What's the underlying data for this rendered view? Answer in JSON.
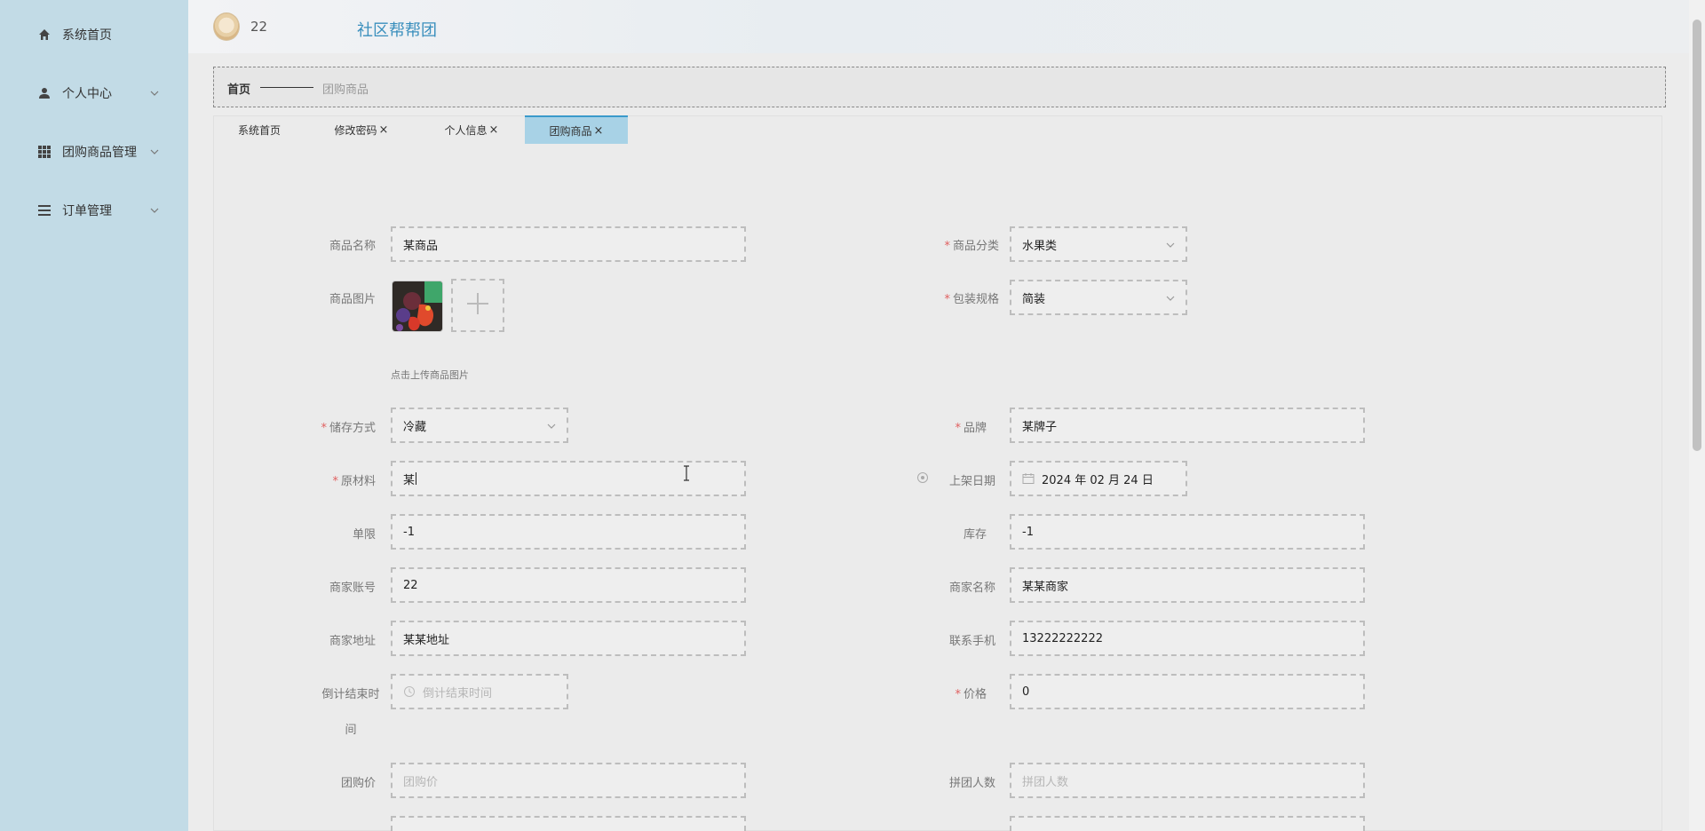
{
  "sidebar": {
    "items": [
      {
        "label": "系统首页",
        "icon": "home-icon"
      },
      {
        "label": "个人中心",
        "icon": "user-icon"
      },
      {
        "label": "团购商品管理",
        "icon": "grid-icon"
      },
      {
        "label": "订单管理",
        "icon": "list-icon"
      }
    ]
  },
  "header": {
    "user_no": "22",
    "site_title": "社区帮帮团"
  },
  "breadcrumb": {
    "home": "首页",
    "current": "团购商品"
  },
  "tabs": [
    {
      "label": "系统首页",
      "closable": false
    },
    {
      "label": "修改密码",
      "closable": true
    },
    {
      "label": "个人信息",
      "closable": true
    },
    {
      "label": "团购商品",
      "closable": true,
      "active": true
    }
  ],
  "tab_close_glyph": "×",
  "form": {
    "name": {
      "label": "商品名称",
      "value": "某商品"
    },
    "category": {
      "label": "商品分类",
      "value": "水果类",
      "required": true
    },
    "image": {
      "label": "商品图片",
      "hint": "点击上传商品图片"
    },
    "package": {
      "label": "包装规格",
      "value": "简装",
      "required": true
    },
    "storage": {
      "label": "储存方式",
      "value": "冷藏",
      "required": true
    },
    "brand": {
      "label": "品牌",
      "value": "某牌子",
      "required": true
    },
    "material": {
      "label": "原材料",
      "value": "某",
      "required": true
    },
    "shelf_date": {
      "label": "上架日期",
      "value": "2024 年 02 月 24 日"
    },
    "limit": {
      "label": "单限",
      "value": "-1"
    },
    "stock": {
      "label": "库存",
      "value": "-1"
    },
    "merchant_account": {
      "label": "商家账号",
      "value": "22"
    },
    "merchant_name": {
      "label": "商家名称",
      "value": "某某商家"
    },
    "merchant_address": {
      "label": "商家地址",
      "value": "某某地址"
    },
    "phone": {
      "label": "联系手机",
      "value": "13222222222"
    },
    "countdown": {
      "label_line1": "倒计结束时",
      "label_line2": "间",
      "placeholder": "倒计结束时间"
    },
    "price": {
      "label": "价格",
      "value": "0",
      "required": true
    },
    "group_price": {
      "label": "团购价",
      "placeholder": "团购价"
    },
    "group_size": {
      "label": "拼团人数",
      "placeholder": "拼团人数"
    }
  },
  "required_mark": "*",
  "colors": {
    "sidebar_bg": "#c2dbe6",
    "accent": "#3a8fbd",
    "active_tab": "#a8d2e6",
    "required": "#e06060"
  }
}
